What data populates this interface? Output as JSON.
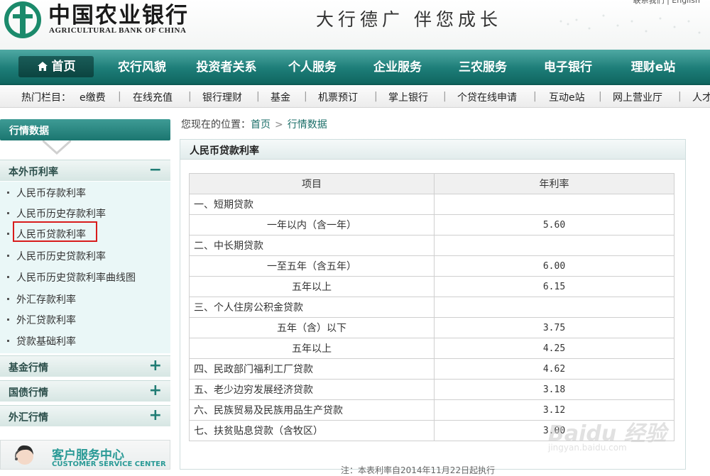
{
  "header": {
    "bank_name_cn": "中国农业银行",
    "bank_name_en": "AGRICULTURAL BANK OF CHINA",
    "slogan": "大行德广  伴您成长",
    "top_links": "联系我们  |  English"
  },
  "nav": {
    "items": [
      "首页",
      "农行风貌",
      "投资者关系",
      "个人服务",
      "企业服务",
      "三农服务",
      "电子银行",
      "理财e站"
    ],
    "active": "首页"
  },
  "hotbar": {
    "label": "热门栏目：",
    "items": [
      "e缴费",
      "在线充值",
      "银行理财",
      "基金",
      "机票预订",
      "掌上银行",
      "个贷在线申请",
      "互动e站",
      "网上营业厅",
      "人才"
    ]
  },
  "sidebar": {
    "title": "行情数据",
    "section_rates": "本外币利率",
    "links": [
      "人民币存款利率",
      "人民币历史存款利率",
      "人民币贷款利率",
      "人民币历史贷款利率",
      "人民币历史贷款利率曲线图",
      "外汇存款利率",
      "外汇贷款利率",
      "贷款基础利率"
    ],
    "section_fund": "基金行情",
    "section_bond": "国债行情",
    "section_fx": "外汇行情",
    "collapse_symbol": "−",
    "expand_symbol": "+",
    "cs_title": "客户服务中心",
    "cs_sub": "CUSTOMER SERVICE CENTER"
  },
  "breadcrumb": {
    "prefix": "您现在的位置：",
    "home": "首页",
    "current": "行情数据"
  },
  "panel": {
    "title": "人民币贷款利率",
    "col_item": "项目",
    "col_rate": "年利率",
    "rows": [
      {
        "label": "一、短期贷款",
        "rate": "",
        "indent": false
      },
      {
        "label": "一年以内（含一年）",
        "rate": "5.60",
        "indent": true
      },
      {
        "label": "二、中长期贷款",
        "rate": "",
        "indent": false
      },
      {
        "label": "一至五年（含五年）",
        "rate": "6.00",
        "indent": true
      },
      {
        "label": "五年以上",
        "rate": "6.15",
        "indent": true
      },
      {
        "label": "三、个人住房公积金贷款",
        "rate": "",
        "indent": false
      },
      {
        "label": "五年（含）以下",
        "rate": "3.75",
        "indent": true
      },
      {
        "label": "五年以上",
        "rate": "4.25",
        "indent": true
      },
      {
        "label": "四、民政部门福利工厂贷款",
        "rate": "4.62",
        "indent": false
      },
      {
        "label": "五、老少边穷发展经济贷款",
        "rate": "3.18",
        "indent": false
      },
      {
        "label": "六、民族贸易及民族用品生产贷款",
        "rate": "3.12",
        "indent": false
      },
      {
        "label": "七、扶贫贴息贷款（含牧区）",
        "rate": "3.00",
        "indent": false
      }
    ],
    "footnote": "注：本表利率自2014年11月22日起执行"
  },
  "watermark": {
    "text": "Baidu 经验",
    "sub": "jingyan.baidu.com"
  },
  "colors": {
    "brand_green": "#1d7d78",
    "highlight_red": "#d81c1c"
  }
}
